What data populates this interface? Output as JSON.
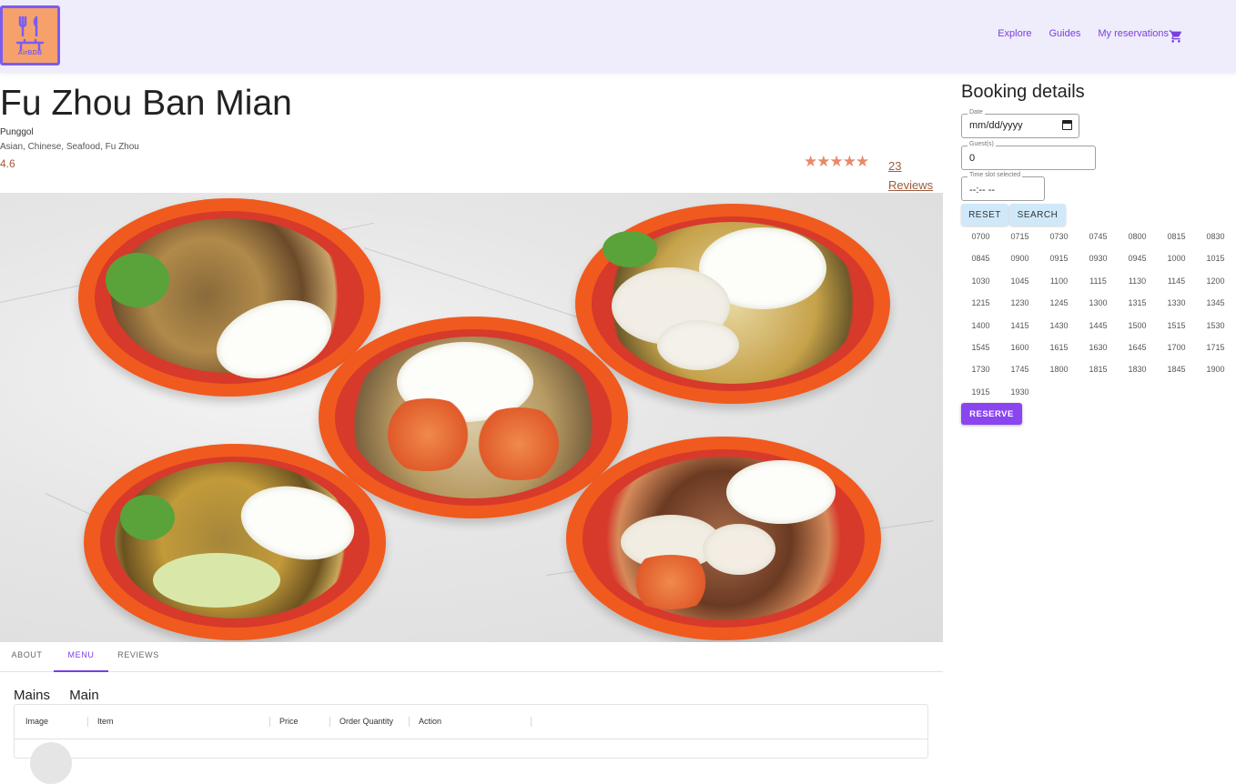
{
  "header": {
    "logo_text": "AirBDB",
    "nav": [
      {
        "label": "Explore"
      },
      {
        "label": "Guides"
      },
      {
        "label": "My reservations"
      }
    ],
    "cart_icon": "shopping-cart-icon",
    "colors": {
      "header_bg": "#efecfb",
      "accent": "#7a3fe0",
      "logo_bg": "#f6a16c"
    }
  },
  "restaurant": {
    "name": "Fu Zhou Ban Mian",
    "area": "Punggol",
    "cuisines": "Asian, Chinese, Seafood, Fu Zhou",
    "rating": "4.6",
    "rating_stars": 4.5,
    "stars_display": "★★★★★",
    "reviews_count": "23",
    "reviews_label": "Reviews"
  },
  "tabs": [
    {
      "label": "ABOUT",
      "active": false
    },
    {
      "label": "MENU",
      "active": true
    },
    {
      "label": "REVIEWS",
      "active": false
    }
  ],
  "menu": {
    "categories": [
      "Mains",
      "Main"
    ],
    "columns": [
      "Image",
      "Item",
      "Price",
      "Order Quantity",
      "Action"
    ]
  },
  "booking": {
    "title": "Booking details",
    "date_label": "Date",
    "date_value": "mm/dd/yyyy",
    "guests_label": "Guest(s)",
    "guests_value": "0",
    "timeslot_label": "Time slot selected",
    "timeslot_value": "--:-- --",
    "reset_label": "RESET",
    "search_label": "SEARCH",
    "slots": [
      "0700",
      "0715",
      "0730",
      "0745",
      "0800",
      "0815",
      "0830",
      "0845",
      "0900",
      "0915",
      "0930",
      "0945",
      "1000",
      "1015",
      "1030",
      "1045",
      "1100",
      "1115",
      "1130",
      "1145",
      "1200",
      "1215",
      "1230",
      "1245",
      "1300",
      "1315",
      "1330",
      "1345",
      "1400",
      "1415",
      "1430",
      "1445",
      "1500",
      "1515",
      "1530",
      "1545",
      "1600",
      "1615",
      "1630",
      "1645",
      "1700",
      "1715",
      "1730",
      "1745",
      "1800",
      "1815",
      "1830",
      "1845",
      "1900",
      "1915",
      "1930"
    ],
    "reserve_label": "RESERVE"
  }
}
